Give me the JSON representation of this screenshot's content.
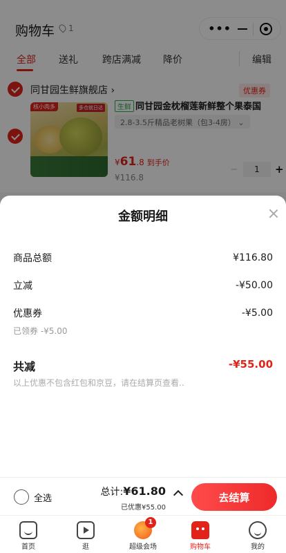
{
  "header": {
    "title": "购物车",
    "location_count": "1"
  },
  "tabs": [
    {
      "label": "全部"
    },
    {
      "label": "送礼"
    },
    {
      "label": "跨店满减"
    },
    {
      "label": "降价"
    }
  ],
  "edit_label": "编辑",
  "shop": {
    "name": "同甘园生鲜旗舰店 ›",
    "coupon_tag": "优惠券",
    "product": {
      "image_tag_left": "核小肉多",
      "image_tag_right": "多仓就日达",
      "fresh_tag": "生鲜",
      "title": "同甘园金枕榴莲新鲜整个果泰国",
      "spec": "2.8-3.5斤精品老树果（包3-4房） ⌄",
      "price_symbol": "¥",
      "price_int": "61",
      "price_dec": ".8",
      "price_label": "到手价",
      "original_price": "¥116.8",
      "quantity": "1"
    }
  },
  "sheet": {
    "title": "金额明细",
    "rows": [
      {
        "label": "商品总额",
        "value": "¥116.80"
      },
      {
        "label": "立减",
        "value": "-¥50.00"
      },
      {
        "label": "优惠券",
        "value": "-¥5.00"
      }
    ],
    "coupon_sub": "已领券 -¥5.00",
    "total_label": "共减",
    "total_value": "-¥55.00",
    "note": "以上优惠不包含红包和京豆，请在结算页查看.."
  },
  "checkout": {
    "select_all": "全选",
    "total_prefix": "总计:",
    "total_amount": "¥61.80",
    "saved": "已优惠¥55.00",
    "button": "去结算"
  },
  "bottom_nav": [
    {
      "label": "首页"
    },
    {
      "label": "逛"
    },
    {
      "label": "超级会场",
      "badge": "1"
    },
    {
      "label": "购物车"
    },
    {
      "label": "我的"
    }
  ],
  "colors": {
    "accent": "#e2231a",
    "fresh": "#2eaa4e"
  }
}
